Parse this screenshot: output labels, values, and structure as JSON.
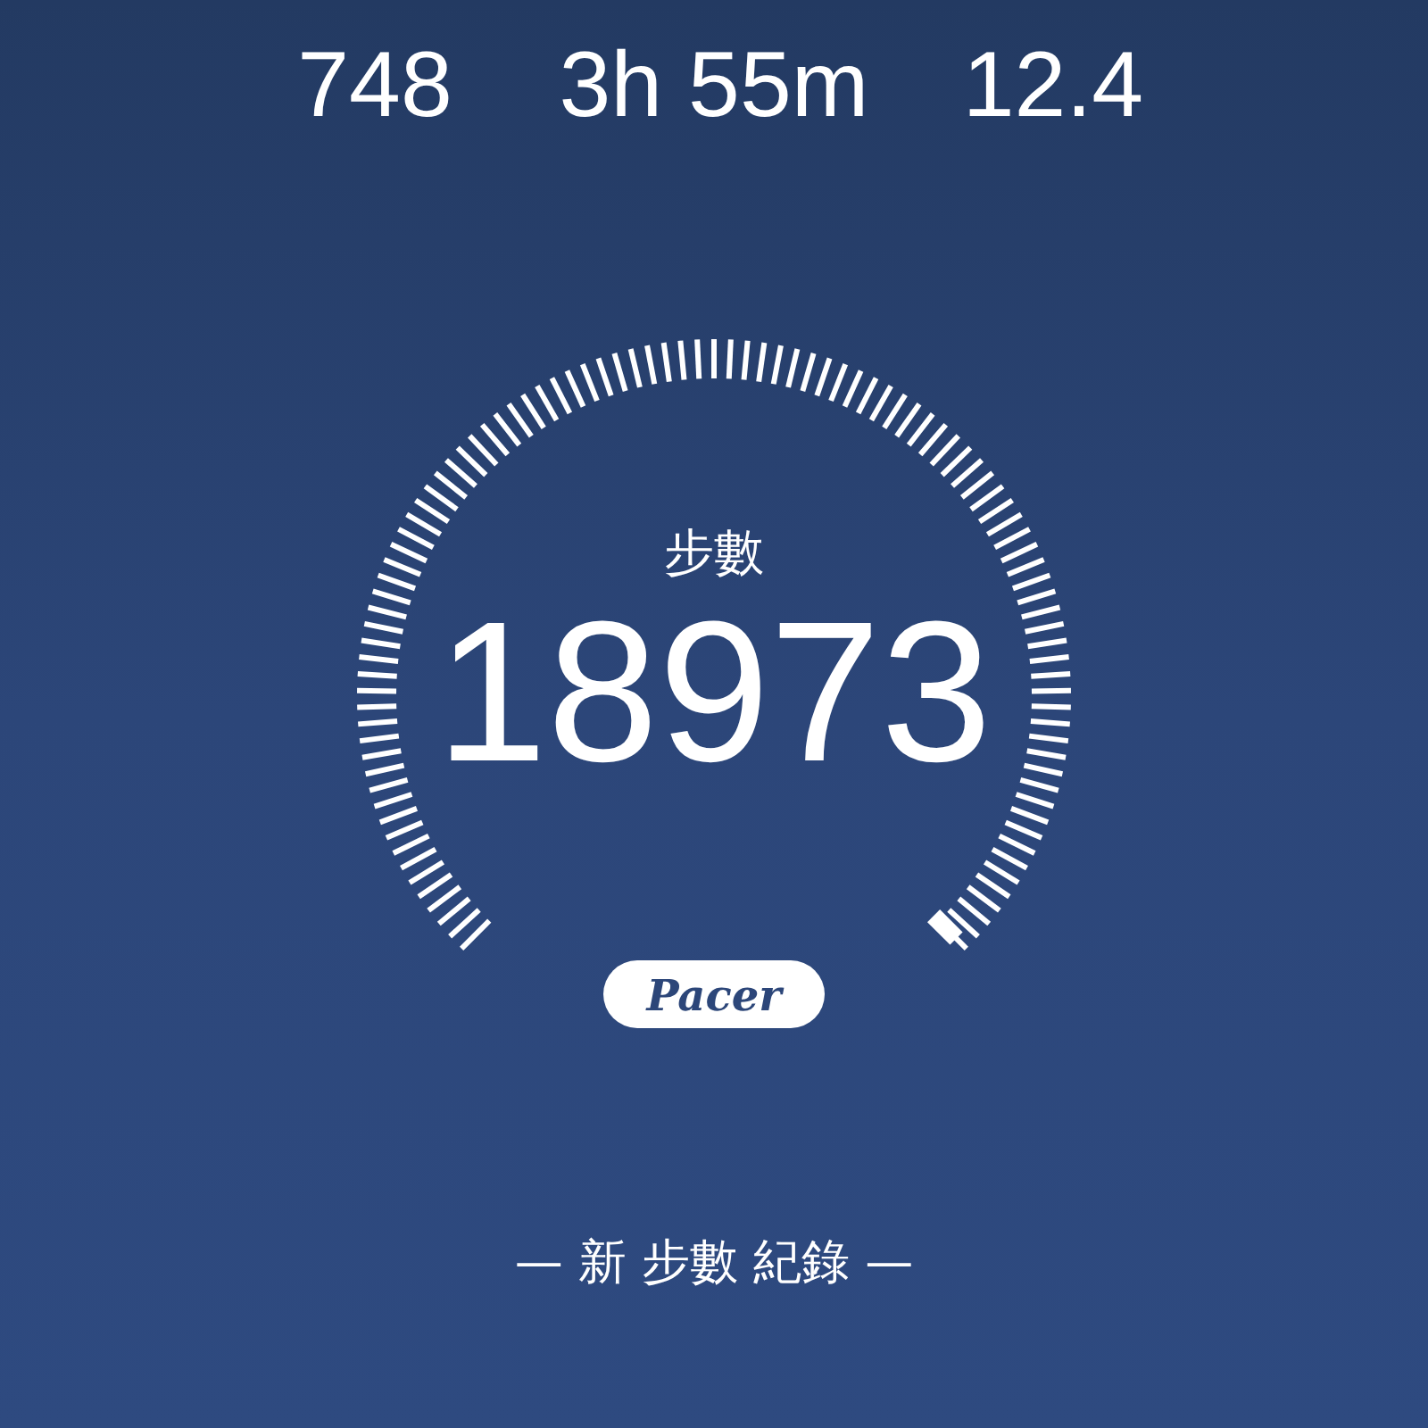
{
  "stats": [
    {
      "value": "748"
    },
    {
      "value": "3h 55m"
    },
    {
      "value": "12.4"
    }
  ],
  "gauge": {
    "label": "步數",
    "value": "18973"
  },
  "logo": "Pacer",
  "record_banner": "— 新 步數 紀錄 —"
}
